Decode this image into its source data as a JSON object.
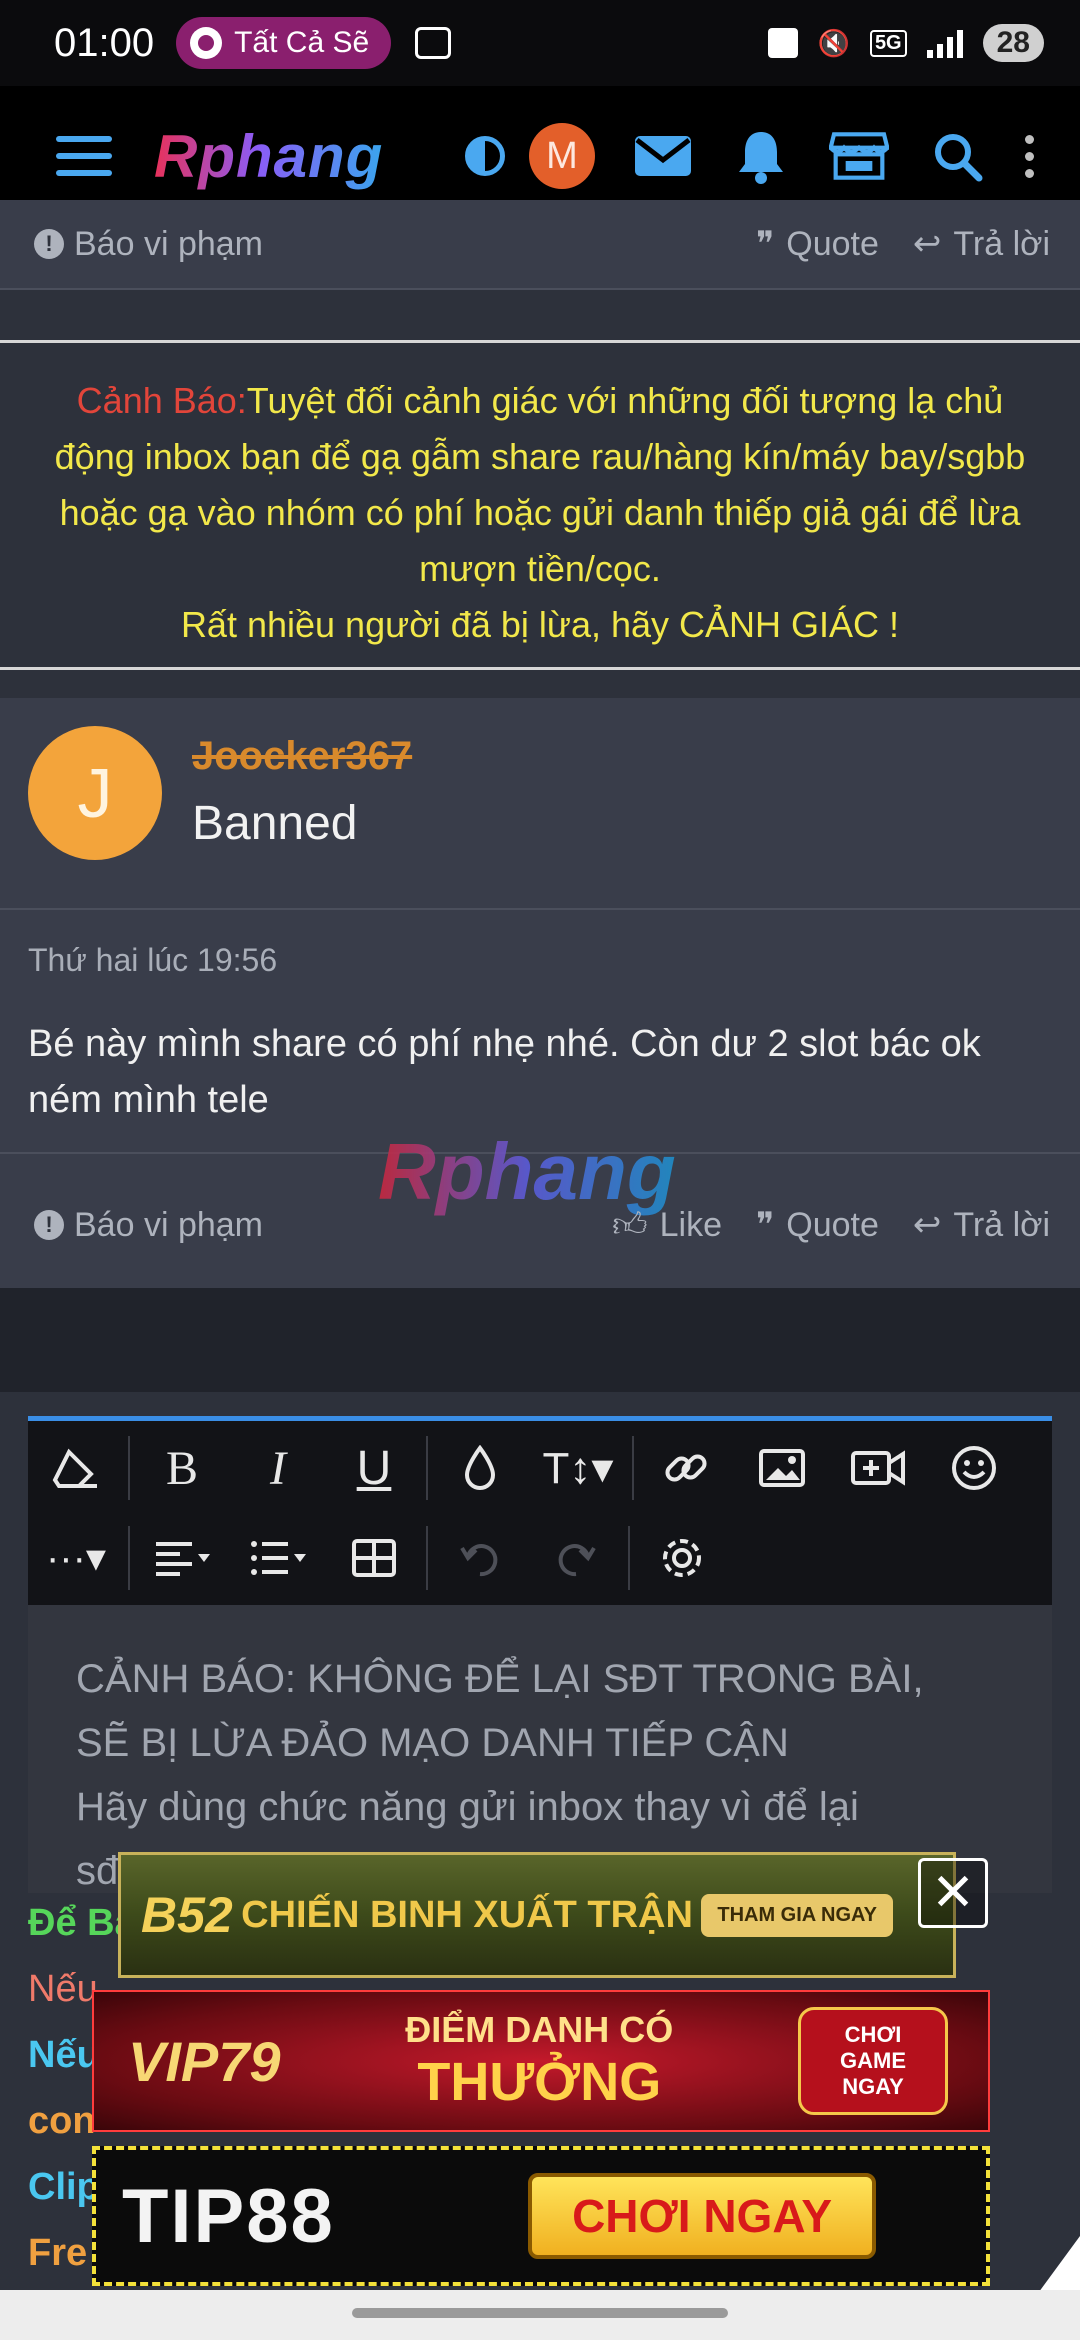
{
  "status_bar": {
    "time": "01:00",
    "pill_text": "Tất Cả Sẽ",
    "network": "5G",
    "battery": "28"
  },
  "nav": {
    "logo": "Rphang",
    "avatar_letter": "M"
  },
  "prev_post_actions": {
    "report": "Báo vi phạm",
    "quote": "Quote",
    "reply": "Trả lời"
  },
  "warning": {
    "label": "Cảnh Báo:",
    "line1": "Tuyệt đối cảnh giác với những đối tượng lạ chủ",
    "line2": "động inbox bạn để gạ gẫm share rau/hàng kín/máy bay/sgbb",
    "line3": "hoặc gạ vào nhóm có phí hoặc gửi danh thiếp giả gái để lừa",
    "line4": "mượn tiền/cọc.",
    "line5": "Rất nhiều người đã bị lừa, hãy CẢNH GIÁC !"
  },
  "post": {
    "avatar_letter": "J",
    "username": "Joocker367",
    "user_title": "Banned",
    "date": "Thứ hai lúc 19:56",
    "text": "Bé này mình share có phí nhẹ nhé. Còn dư 2 slot bác ok ném mình tele",
    "watermark": "Rphang"
  },
  "post_actions": {
    "report": "Báo vi phạm",
    "like": "Like",
    "quote": "Quote",
    "reply": "Trả lời"
  },
  "editor": {
    "placeholder_line1": "CẢNH BÁO: KHÔNG ĐỂ LẠI SĐT TRONG BÀI,",
    "placeholder_line2": "SẼ BỊ LỪA ĐẢO MẠO DANH TIẾP CẬN",
    "placeholder_line3": "Hãy dùng chức năng gửi inbox thay vì để lại",
    "placeholder_line4": "sđ"
  },
  "below_editor": {
    "l1": "Để Bá",
    "l2": "Nếu",
    "l3": "Nếu",
    "l4": "con",
    "l5": "Clip",
    "l6": "Fre"
  },
  "ads": {
    "ad1_brand": "B52",
    "ad1_text": "CHIẾN BINH XUẤT TRẬN",
    "ad1_button": "THAM GIA NGAY",
    "ad2_brand": "VIP79",
    "ad2_text_top": "ĐIỂM DANH CÓ",
    "ad2_text_bottom": "THƯỞNG",
    "ad2_button": "CHƠI GAME NGAY",
    "ad3_brand": "TIP88",
    "ad3_button": "CHƠI NGAY",
    "close_symbol": "✕"
  }
}
